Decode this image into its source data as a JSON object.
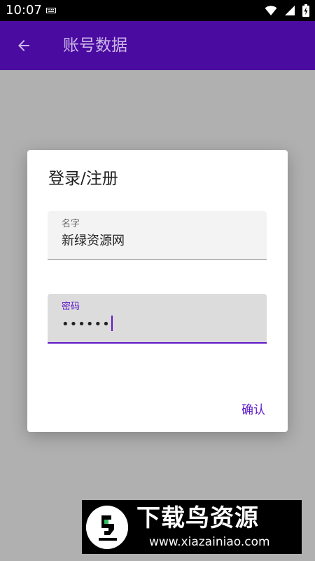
{
  "status_bar": {
    "time": "10:07",
    "icons": [
      "keyboard-icon",
      "wifi-icon",
      "signal-icon",
      "battery-icon"
    ]
  },
  "app_bar": {
    "title": "账号数据",
    "back_icon": "arrow-left-icon",
    "background": "#4a0ba0"
  },
  "dialog": {
    "title": "登录/注册",
    "name_field": {
      "label": "名字",
      "value": "新绿资源网"
    },
    "password_field": {
      "label": "密码",
      "value": "••••••"
    },
    "confirm_label": "确认"
  },
  "watermark": {
    "text": "下载鸟资源",
    "url": "www.xiazainiao.com"
  },
  "colors": {
    "accent": "#5e17c8",
    "scrim": "#b0b0b0"
  }
}
